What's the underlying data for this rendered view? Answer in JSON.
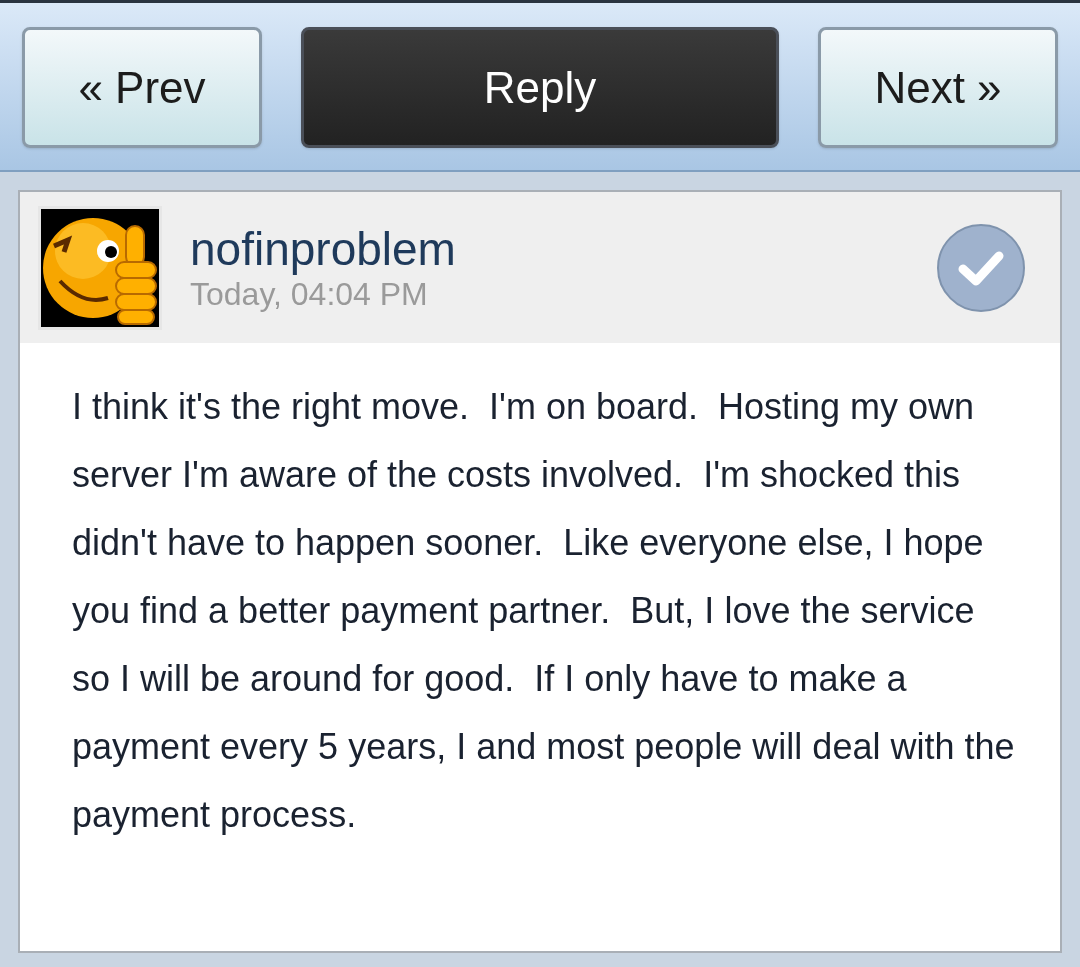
{
  "nav_buttons": [
    {
      "label": "« Prev",
      "kind": "light"
    },
    {
      "label": "Reply",
      "kind": "dark"
    },
    {
      "label": "Next »",
      "kind": "light"
    }
  ],
  "post": {
    "author": "nofinproblem",
    "time": "Today, 04:04 PM",
    "body": "I think it's the right move.  I'm on board.  Hosting my own server I'm aware of the costs involved.  I'm shocked this didn't have to happen sooner.  Like everyone else, I hope you find a better payment partner.  But, I love the service so I will be around for good.  If I only have to make a payment every 5 years, I and most people will deal with the payment process."
  }
}
